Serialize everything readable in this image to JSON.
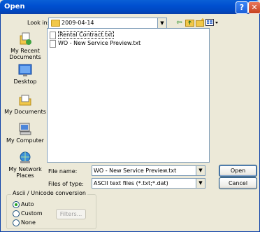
{
  "window": {
    "title": "Open",
    "help_label": "?",
    "close_label": "✕"
  },
  "lookin": {
    "label": "Look in:",
    "value": "2009-04-14"
  },
  "toolbar": {
    "icons": [
      "back-icon",
      "up-folder-icon",
      "new-folder-icon",
      "views-menu-icon"
    ]
  },
  "places": [
    {
      "label": "My Recent Documents",
      "icon": "recent-documents-icon"
    },
    {
      "label": "Desktop",
      "icon": "desktop-icon"
    },
    {
      "label": "My Documents",
      "icon": "my-documents-icon"
    },
    {
      "label": "My Computer",
      "icon": "my-computer-icon"
    },
    {
      "label": "My Network Places",
      "icon": "network-places-icon"
    }
  ],
  "files": [
    {
      "name": "Rental Contract.txt"
    },
    {
      "name": "WO - New Service Preview.txt"
    }
  ],
  "filename": {
    "label": "File name:",
    "value": "WO - New Service Preview.txt"
  },
  "filetype": {
    "label": "Files of type:",
    "value": "ASCII text files (*.txt;*.dat)"
  },
  "buttons": {
    "open": "Open",
    "cancel": "Cancel",
    "filters": "Filters..."
  },
  "conversion": {
    "title": "Ascii / Unicode conversion",
    "options": [
      "Auto",
      "Custom",
      "None"
    ],
    "selected": "Auto"
  }
}
